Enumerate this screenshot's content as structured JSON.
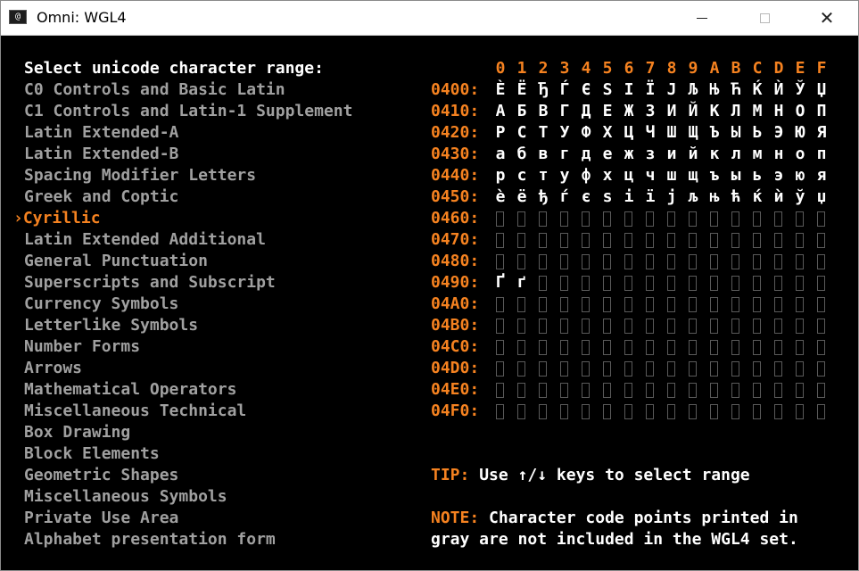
{
  "window": {
    "title": "Omni: WGL4",
    "close_label": "✕"
  },
  "menu": {
    "header": "Select unicode character range:",
    "selected_index": 6,
    "cursor": "›",
    "ranges": [
      "C0 Controls and Basic Latin",
      "C1 Controls and Latin-1 Supplement",
      "Latin Extended-A",
      "Latin Extended-B",
      "Spacing Modifier Letters",
      "Greek and Coptic",
      "Cyrillic",
      "Latin Extended Additional",
      "General Punctuation",
      "Superscripts and Subscript",
      "Currency Symbols",
      "Letterlike Symbols",
      "Number Forms",
      "Arrows",
      "Mathematical Operators",
      "Miscellaneous Technical",
      "Box Drawing",
      "Block Elements",
      "Geometric Shapes",
      "Miscellaneous Symbols",
      "Private Use Area",
      "Alphabet presentation form"
    ]
  },
  "grid": {
    "column_headers": [
      "0",
      "1",
      "2",
      "3",
      "4",
      "5",
      "6",
      "7",
      "8",
      "9",
      "A",
      "B",
      "C",
      "D",
      "E",
      "F"
    ],
    "rows": [
      {
        "label": "0400:",
        "chars": [
          "È",
          "Ё",
          "Ђ",
          "Ѓ",
          "Є",
          "Ѕ",
          "І",
          "Ї",
          "Ј",
          "Љ",
          "Њ",
          "Ћ",
          "Ќ",
          "Ѝ",
          "Ў",
          "Џ"
        ]
      },
      {
        "label": "0410:",
        "chars": [
          "А",
          "Б",
          "В",
          "Г",
          "Д",
          "Е",
          "Ж",
          "З",
          "И",
          "Й",
          "К",
          "Л",
          "М",
          "Н",
          "О",
          "П"
        ]
      },
      {
        "label": "0420:",
        "chars": [
          "Р",
          "С",
          "Т",
          "У",
          "Ф",
          "Х",
          "Ц",
          "Ч",
          "Ш",
          "Щ",
          "Ъ",
          "Ы",
          "Ь",
          "Э",
          "Ю",
          "Я"
        ]
      },
      {
        "label": "0430:",
        "chars": [
          "а",
          "б",
          "в",
          "г",
          "д",
          "е",
          "ж",
          "з",
          "и",
          "й",
          "к",
          "л",
          "м",
          "н",
          "о",
          "п"
        ]
      },
      {
        "label": "0440:",
        "chars": [
          "р",
          "с",
          "т",
          "у",
          "ф",
          "х",
          "ц",
          "ч",
          "ш",
          "щ",
          "ъ",
          "ы",
          "ь",
          "э",
          "ю",
          "я"
        ]
      },
      {
        "label": "0450:",
        "chars": [
          "è",
          "ё",
          "ђ",
          "ѓ",
          "є",
          "ѕ",
          "і",
          "ї",
          "ј",
          "љ",
          "њ",
          "ћ",
          "ќ",
          "ѝ",
          "ў",
          "џ"
        ]
      },
      {
        "label": "0460:",
        "chars": [
          "",
          "",
          "",
          "",
          "",
          "",
          "",
          "",
          "",
          "",
          "",
          "",
          "",
          "",
          "",
          ""
        ]
      },
      {
        "label": "0470:",
        "chars": [
          "",
          "",
          "",
          "",
          "",
          "",
          "",
          "",
          "",
          "",
          "",
          "",
          "",
          "",
          "",
          ""
        ]
      },
      {
        "label": "0480:",
        "chars": [
          "",
          "",
          "",
          "",
          "",
          "",
          "",
          "",
          "",
          "",
          "",
          "",
          "",
          "",
          "",
          ""
        ]
      },
      {
        "label": "0490:",
        "chars": [
          "Ґ",
          "ґ",
          "",
          "",
          "",
          "",
          "",
          "",
          "",
          "",
          "",
          "",
          "",
          "",
          "",
          ""
        ]
      },
      {
        "label": "04A0:",
        "chars": [
          "",
          "",
          "",
          "",
          "",
          "",
          "",
          "",
          "",
          "",
          "",
          "",
          "",
          "",
          "",
          ""
        ]
      },
      {
        "label": "04B0:",
        "chars": [
          "",
          "",
          "",
          "",
          "",
          "",
          "",
          "",
          "",
          "",
          "",
          "",
          "",
          "",
          "",
          ""
        ]
      },
      {
        "label": "04C0:",
        "chars": [
          "",
          "",
          "",
          "",
          "",
          "",
          "",
          "",
          "",
          "",
          "",
          "",
          "",
          "",
          "",
          ""
        ]
      },
      {
        "label": "04D0:",
        "chars": [
          "",
          "",
          "",
          "",
          "",
          "",
          "",
          "",
          "",
          "",
          "",
          "",
          "",
          "",
          "",
          ""
        ]
      },
      {
        "label": "04E0:",
        "chars": [
          "",
          "",
          "",
          "",
          "",
          "",
          "",
          "",
          "",
          "",
          "",
          "",
          "",
          "",
          "",
          ""
        ]
      },
      {
        "label": "04F0:",
        "chars": [
          "",
          "",
          "",
          "",
          "",
          "",
          "",
          "",
          "",
          "",
          "",
          "",
          "",
          "",
          "",
          ""
        ]
      }
    ]
  },
  "tip": {
    "label": "TIP:",
    "text": " Use ↑/↓ keys to select range"
  },
  "note": {
    "label": "NOTE:",
    "line1": " Character code points printed in",
    "line2": "gray are not included in the WGL4 set."
  },
  "colors": {
    "accent": "#f58220",
    "text": "#ffffff",
    "dim": "#a0a0a0",
    "background": "#000000"
  }
}
